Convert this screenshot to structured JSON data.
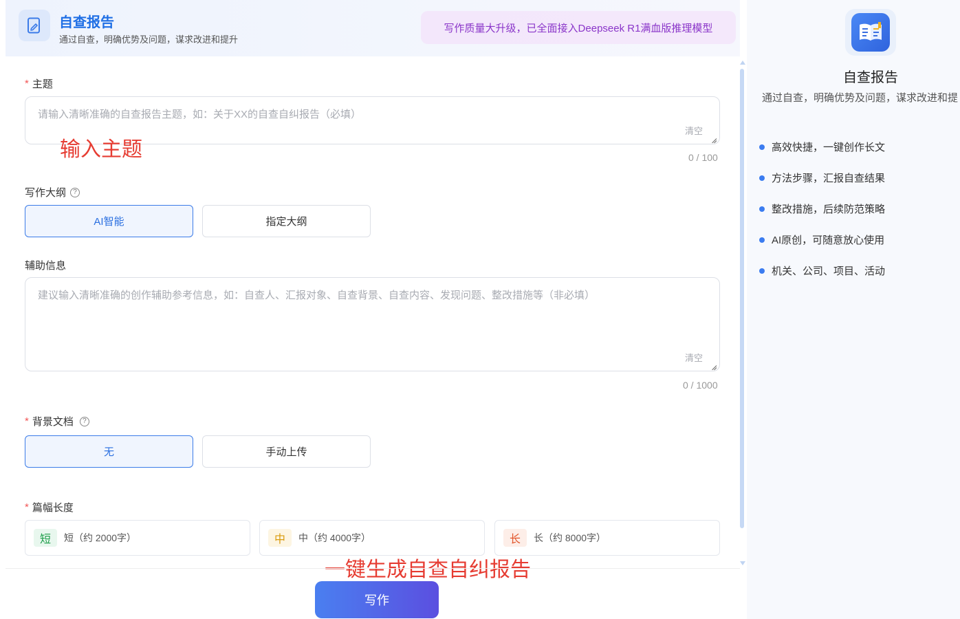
{
  "header": {
    "title": "自查报告",
    "subtitle": "通过自查，明确优势及问题，谋求改进和提升",
    "icon": "edit-document-icon",
    "promo": "写作质量大升级，已全面接入Deepseek R1满血版推理模型"
  },
  "form": {
    "topic": {
      "required_mark": "*",
      "label": "主题",
      "placeholder": "请输入清晰准确的自查报告主题，如：关于XX的自查自纠报告（必填）",
      "value": "",
      "clear_label": "清空",
      "counter": "0 / 100"
    },
    "outline": {
      "label": "写作大纲",
      "help_icon": "question-circle-icon",
      "help_glyph": "?",
      "options": [
        "AI智能",
        "指定大纲"
      ],
      "selected": "AI智能"
    },
    "aux_info": {
      "label": "辅助信息",
      "placeholder": "建议输入清晰准确的创作辅助参考信息，如：自查人、汇报对象、自查背景、自查内容、发现问题、整改措施等（非必填）",
      "value": "",
      "clear_label": "清空",
      "counter": "0 / 1000"
    },
    "background_doc": {
      "required_mark": "*",
      "label": "背景文档",
      "help_icon": "question-circle-icon",
      "help_glyph": "?",
      "options": [
        "无",
        "手动上传"
      ],
      "selected": "无"
    },
    "length": {
      "required_mark": "*",
      "label": "篇幅长度",
      "options": [
        {
          "badge": "短",
          "label": "短（约 2000字）",
          "badge_color": "#1e9e4a",
          "badge_bg": "#e8f7ee"
        },
        {
          "badge": "中",
          "label": "中（约 4000字）",
          "badge_color": "#d99a0c",
          "badge_bg": "#fdf5e2"
        },
        {
          "badge": "长",
          "label": "长（约 8000字）",
          "badge_color": "#e2552b",
          "badge_bg": "#fdeee8"
        }
      ]
    }
  },
  "annotations": {
    "topic_hint": "输入主题",
    "generate_hint": "一键生成自查自纠报告"
  },
  "write_button": "写作",
  "side_panel": {
    "icon": "book-app-icon",
    "title": "自查报告",
    "subtitle": "通过自查，明确优势及问题，谋求改进和提",
    "features": [
      "高效快捷，一键创作长文",
      "方法步骤，汇报自查结果",
      "整改措施，后续防范策略",
      "AI原创，可随意放心使用",
      "机关、公司、项目、活动"
    ]
  },
  "colors": {
    "accent": "#2a6fe0",
    "promo_text": "#8a35c9",
    "required": "#f25656",
    "annotation": "#e63c32",
    "button_gradient_start": "#4a7ff0",
    "button_gradient_end": "#5b4fe0"
  }
}
